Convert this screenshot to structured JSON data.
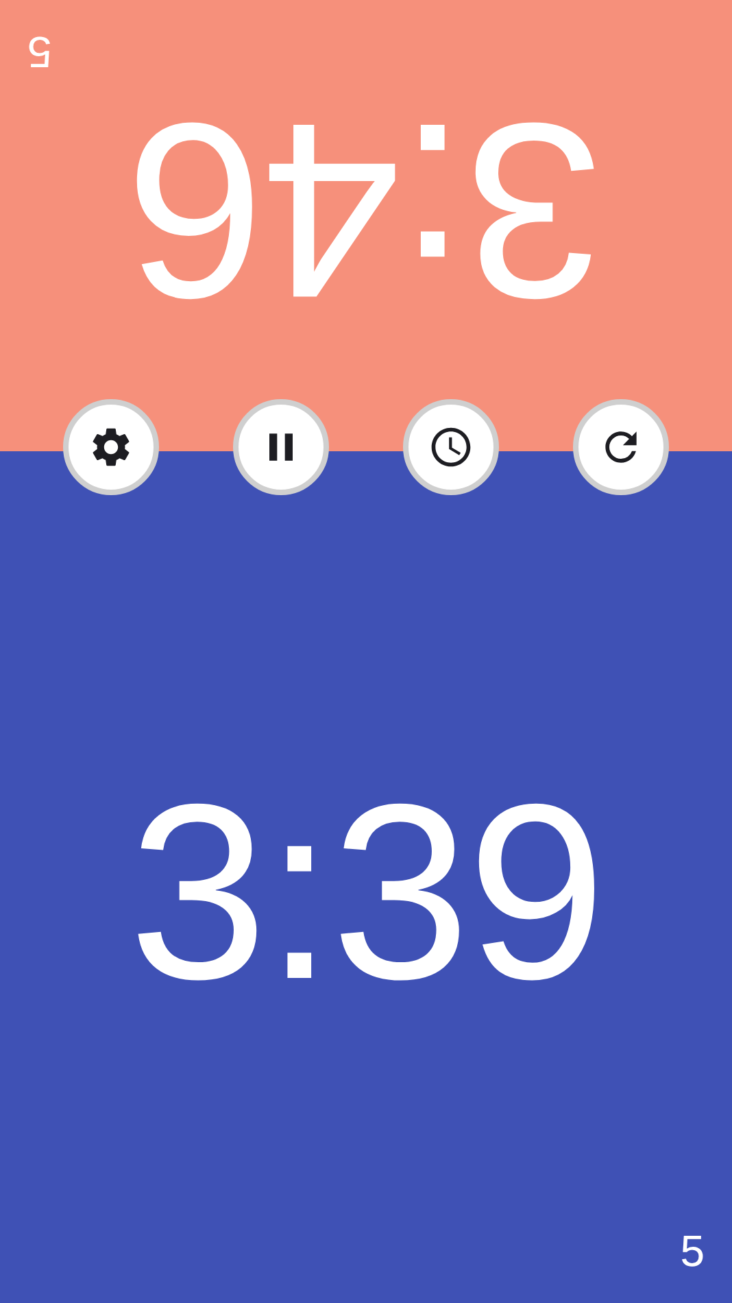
{
  "players": [
    {
      "time": "3:46",
      "moves": "5",
      "color": "#f6907b",
      "flipped": true
    },
    {
      "time": "3:39",
      "moves": "5",
      "color": "#3f51b5",
      "flipped": false
    }
  ],
  "controls": [
    {
      "kind": "settings"
    },
    {
      "kind": "pause"
    },
    {
      "kind": "clock"
    },
    {
      "kind": "reset"
    }
  ]
}
